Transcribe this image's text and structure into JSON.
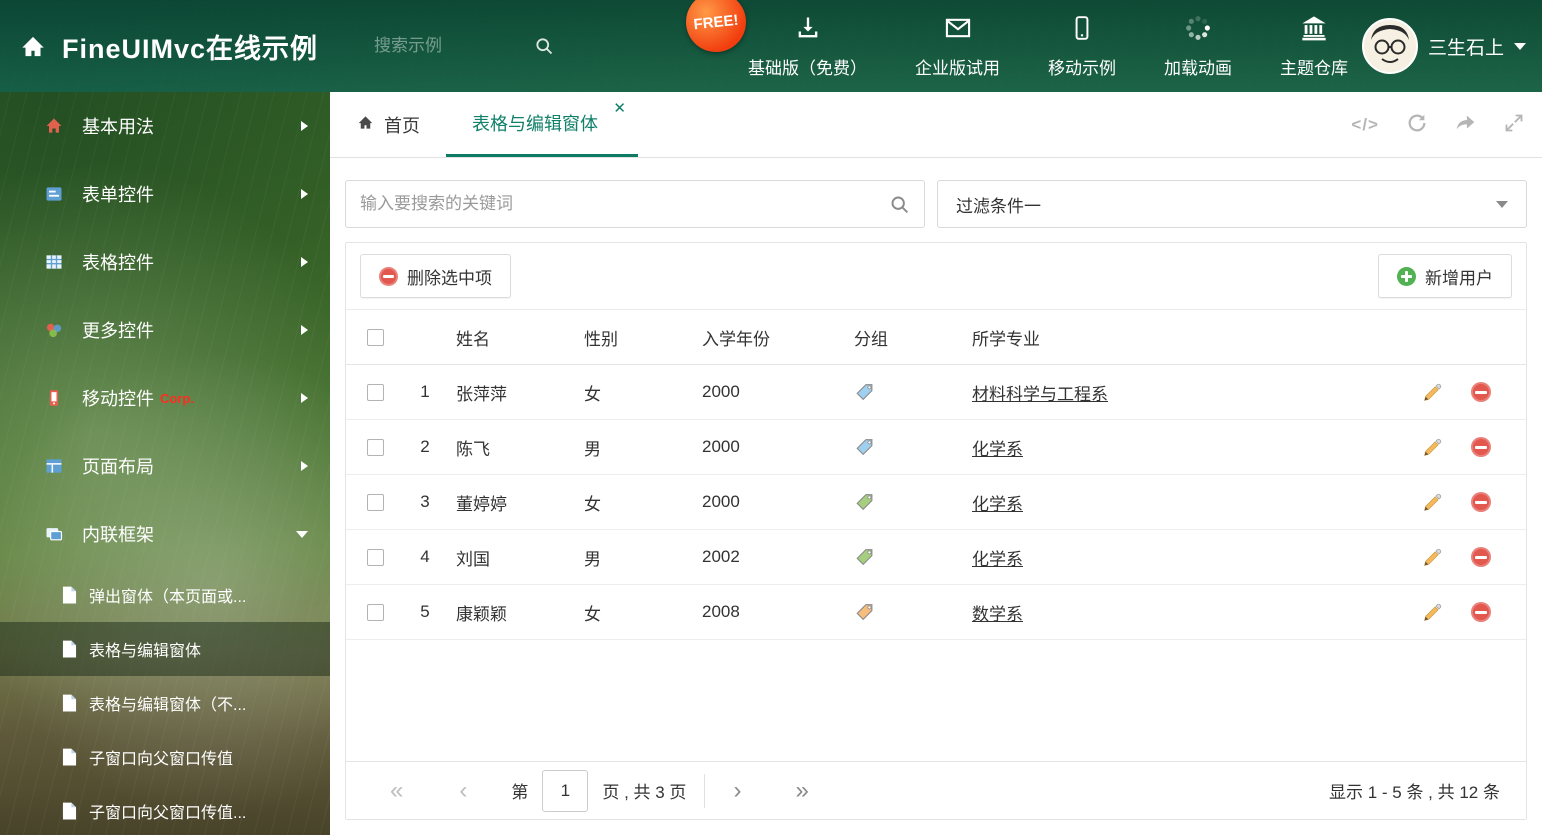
{
  "header": {
    "title": "FineUIMvc在线示例",
    "search_placeholder": "搜索示例",
    "free_badge": "FREE!",
    "nav": [
      {
        "label": "基础版（免费）",
        "icon": "download-icon"
      },
      {
        "label": "企业版试用",
        "icon": "envelope-icon"
      },
      {
        "label": "移动示例",
        "icon": "mobile-icon"
      },
      {
        "label": "加载动画",
        "icon": "spinner-icon"
      },
      {
        "label": "主题仓库",
        "icon": "bank-icon"
      }
    ],
    "user_name": "三生石上"
  },
  "sidebar": {
    "items": [
      {
        "label": "基本用法"
      },
      {
        "label": "表单控件"
      },
      {
        "label": "表格控件"
      },
      {
        "label": "更多控件"
      },
      {
        "label": "移动控件",
        "badge": "Corp."
      },
      {
        "label": "页面布局"
      },
      {
        "label": "内联框架"
      }
    ],
    "subitems": [
      {
        "label": "弹出窗体（本页面或..."
      },
      {
        "label": "表格与编辑窗体"
      },
      {
        "label": "表格与编辑窗体（不..."
      },
      {
        "label": "子窗口向父窗口传值"
      },
      {
        "label": "子窗口向父窗口传值..."
      }
    ]
  },
  "tabs": {
    "home": "首页",
    "active": "表格与编辑窗体"
  },
  "filters": {
    "search_placeholder": "输入要搜索的关键词",
    "filter_value": "过滤条件一"
  },
  "toolbar": {
    "delete_label": "删除选中项",
    "add_label": "新增用户"
  },
  "table": {
    "columns": {
      "name": "姓名",
      "gender": "性别",
      "year": "入学年份",
      "group": "分组",
      "major": "所学专业"
    },
    "rows": [
      {
        "index": "1",
        "name": "张萍萍",
        "gender": "女",
        "year": "2000",
        "tag_color": "blue",
        "major": "材料科学与工程系"
      },
      {
        "index": "2",
        "name": "陈飞",
        "gender": "男",
        "year": "2000",
        "tag_color": "blue",
        "major": "化学系"
      },
      {
        "index": "3",
        "name": "董婷婷",
        "gender": "女",
        "year": "2000",
        "tag_color": "green",
        "major": "化学系"
      },
      {
        "index": "4",
        "name": "刘国",
        "gender": "男",
        "year": "2002",
        "tag_color": "green",
        "major": "化学系"
      },
      {
        "index": "5",
        "name": "康颖颖",
        "gender": "女",
        "year": "2008",
        "tag_color": "orange",
        "major": "数学系"
      }
    ]
  },
  "pagination": {
    "prefix": "第",
    "page": "1",
    "suffix": "页 , 共 3 页",
    "summary": "显示 1 - 5 条 , 共 12 条"
  },
  "colors": {
    "theme": "#0f7a64",
    "header_green": "#15624d",
    "tag_blue": "#9fd0ef",
    "tag_green": "#a5cf7e",
    "tag_orange": "#f6bd7d",
    "delete_red": "#e2574e",
    "add_green": "#52b152",
    "corp_red": "#ff2d1f"
  }
}
